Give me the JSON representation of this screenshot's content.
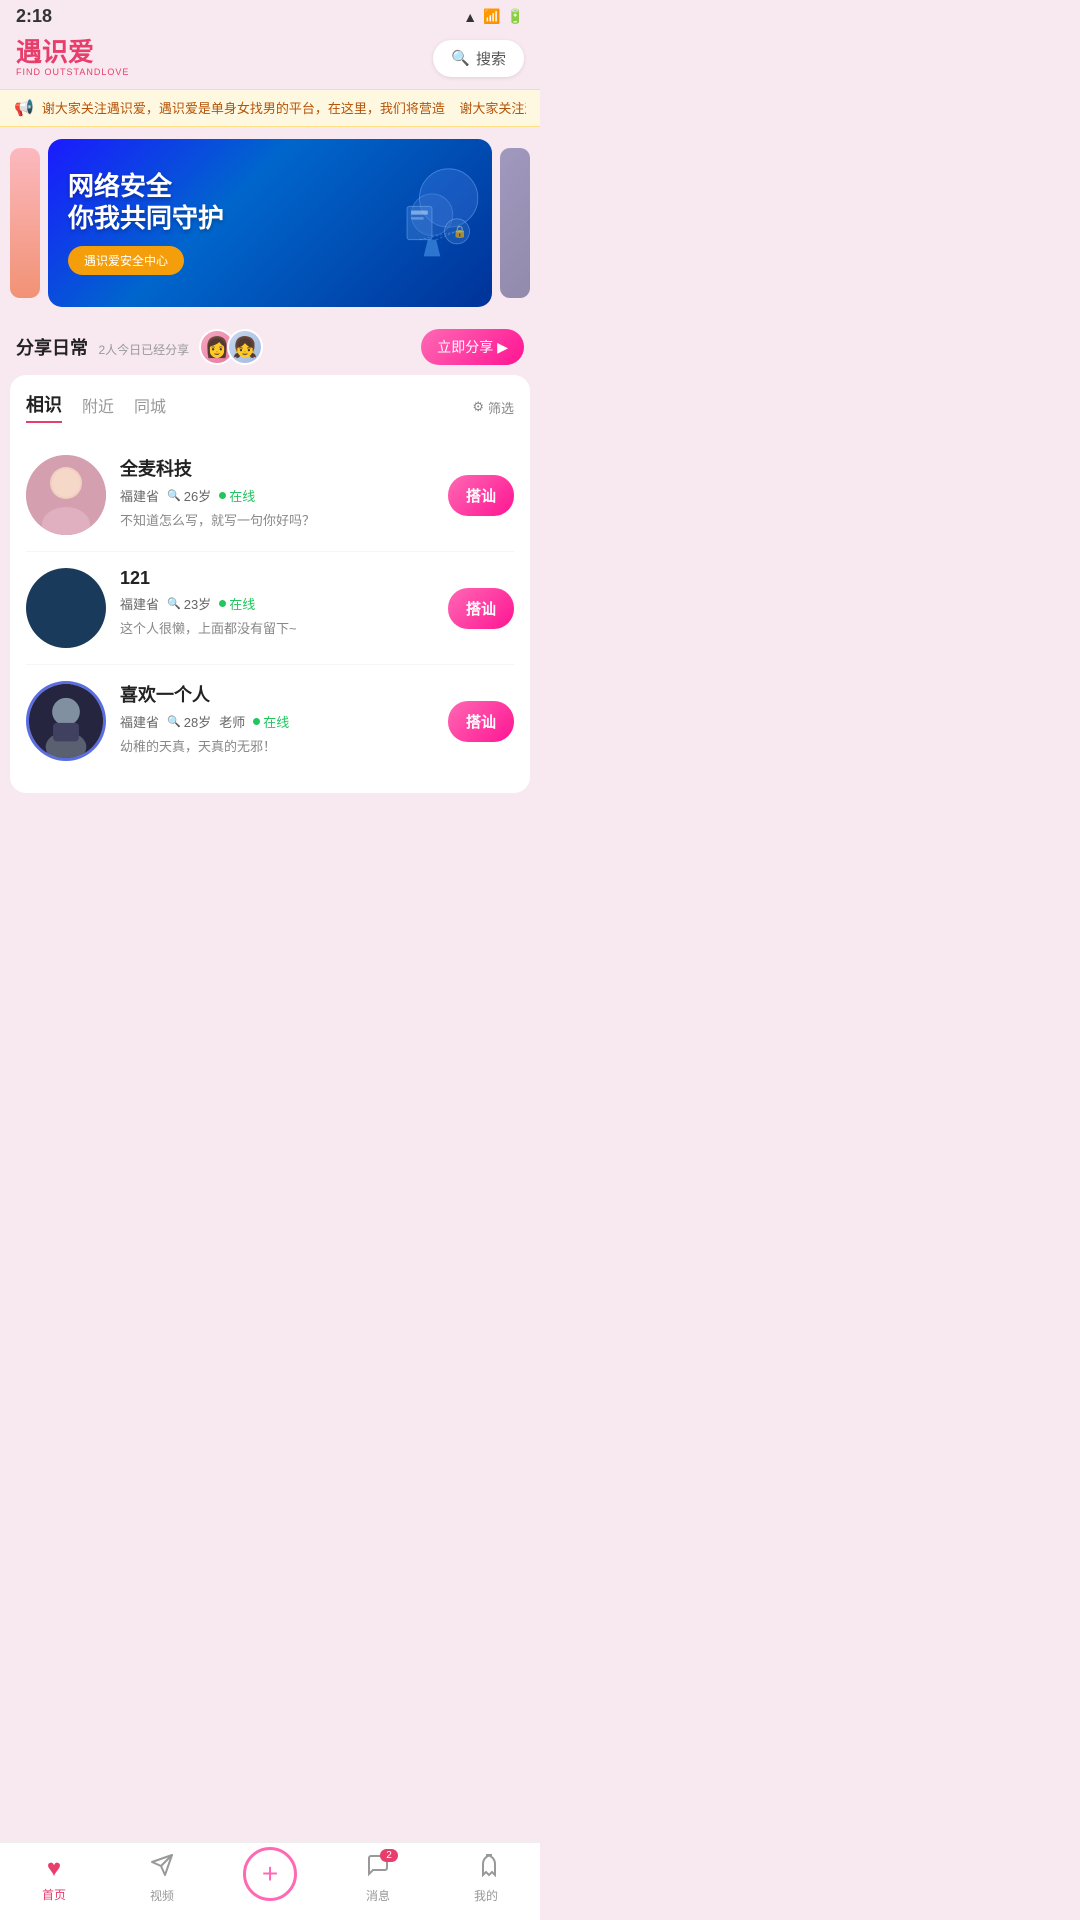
{
  "statusBar": {
    "time": "2:18",
    "icons": [
      "wifi",
      "signal",
      "battery"
    ]
  },
  "header": {
    "logoText": "遇识爱",
    "logoSub": "FIND OUTSTANDLOVE",
    "searchLabel": "搜索"
  },
  "marquee": {
    "text": "谢大家关注遇识爱，遇识爱是单身女找男的平台，在这里，我们将营造"
  },
  "banner": {
    "title1": "网络安全",
    "title2": "你我共同守护",
    "btnLabel": "遇识爱安全中心"
  },
  "shareSection": {
    "title": "分享日常",
    "subtitle": "2人今日已经分享",
    "btnLabel": "立即分享",
    "btnIcon": "▶"
  },
  "tabs": {
    "items": [
      "相识",
      "附近",
      "同城"
    ],
    "activeIndex": 0,
    "filterLabel": "筛选"
  },
  "users": [
    {
      "name": "全麦科技",
      "location": "福建省",
      "age": "26岁",
      "job": "",
      "online": true,
      "onlineLabel": "在线",
      "bio": "不知道怎么写，就写一句你好吗？",
      "btnLabel": "搭讪",
      "avatarType": "pink-face"
    },
    {
      "name": "121",
      "location": "福建省",
      "age": "23岁",
      "job": "",
      "online": true,
      "onlineLabel": "在线",
      "bio": "这个人很懒，上面都没有留下~",
      "btnLabel": "搭讪",
      "avatarType": "blue-plain"
    },
    {
      "name": "喜欢一个人",
      "location": "福建省",
      "age": "28岁",
      "job": "老师",
      "online": true,
      "onlineLabel": "在线",
      "bio": "幼稚的天真，天真的无邪！",
      "btnLabel": "搭讪",
      "avatarType": "dark-ring"
    }
  ],
  "bottomNav": {
    "items": [
      {
        "label": "首页",
        "icon": "heart",
        "active": true
      },
      {
        "label": "视频",
        "icon": "send",
        "active": false
      },
      {
        "label": "",
        "icon": "plus",
        "active": false
      },
      {
        "label": "消息",
        "icon": "chat",
        "active": false,
        "badge": "2"
      },
      {
        "label": "我的",
        "icon": "ghost",
        "active": false
      }
    ]
  }
}
